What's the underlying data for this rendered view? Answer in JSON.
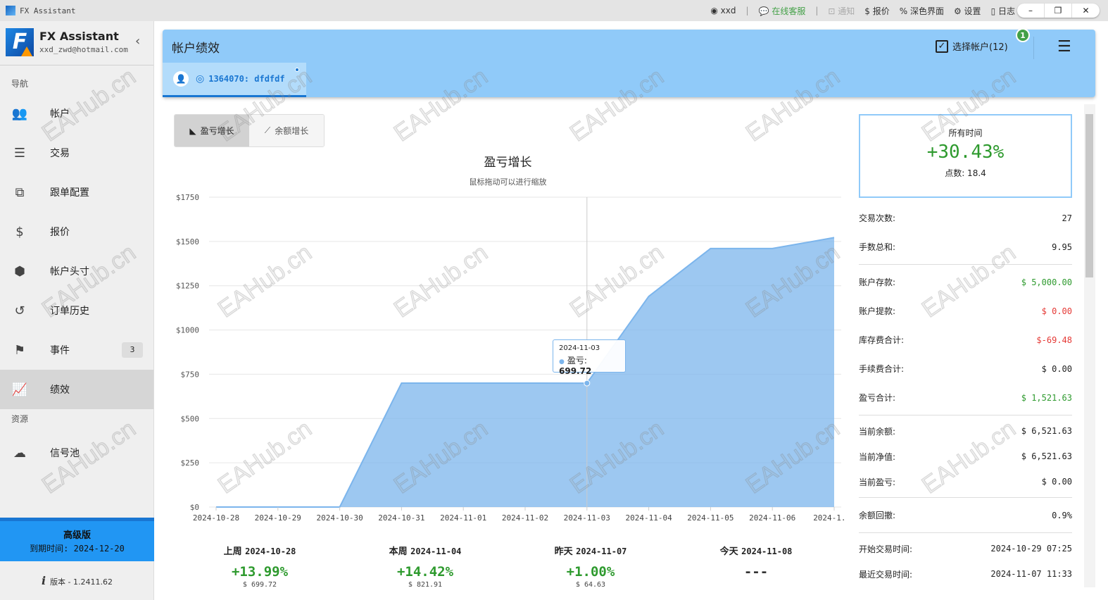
{
  "titlebar": {
    "title": "FX Assistant",
    "user": "xxd",
    "support": "在线客服",
    "notify": "通知",
    "quote": "报价",
    "dark": "深色界面",
    "settings": "设置",
    "log": "日志",
    "min": "–",
    "max": "❐",
    "close": "✕",
    "sep": "|"
  },
  "sidebar": {
    "app_name": "FX Assistant",
    "email": "xxd_zwd@hotmail.com",
    "nav_section": "导航",
    "items": [
      {
        "label": "帐户",
        "icon": "👥"
      },
      {
        "label": "交易",
        "icon": "☰"
      },
      {
        "label": "跟单配置",
        "icon": "⧉"
      },
      {
        "label": "报价",
        "icon": "$"
      },
      {
        "label": "帐户头寸",
        "icon": "⬢"
      },
      {
        "label": "订单历史",
        "icon": "↺"
      },
      {
        "label": "事件",
        "icon": "⚑",
        "badge": "3"
      },
      {
        "label": "绩效",
        "icon": "📈"
      }
    ],
    "res_section": "资源",
    "res_items": [
      {
        "label": "信号池",
        "icon": "☁"
      }
    ],
    "plan": "高级版",
    "expiry": "到期时间: 2024-12-20",
    "version": "版本 - 1.2411.62"
  },
  "header": {
    "title": "帐户绩效",
    "account": "1364070: dfdfdf",
    "select_accounts": "选择帐户(12)",
    "notif_count": "1"
  },
  "toggle": {
    "pnl": "盈亏增长",
    "balance": "余额增长"
  },
  "tooltip": {
    "date": "2024-11-03",
    "label": "盈亏:",
    "value": "699.72"
  },
  "chart_data": {
    "type": "area",
    "title": "盈亏增长",
    "subtitle": "鼠标拖动可以进行缩放",
    "x": [
      "2024-10-28",
      "2024-10-29",
      "2024-10-30",
      "2024-10-31",
      "2024-11-01",
      "2024-11-02",
      "2024-11-03",
      "2024-11-04",
      "2024-11-05",
      "2024-11-06",
      "2024-1..."
    ],
    "values": [
      0,
      0,
      0,
      700,
      700,
      700,
      699.72,
      1190,
      1460,
      1460,
      1521.63
    ],
    "yticks": [
      "$0",
      "$250",
      "$500",
      "$750",
      "$1000",
      "$1250",
      "$1500",
      "$1750"
    ],
    "ylim": [
      0,
      1750
    ],
    "color": "#7cb5ec",
    "grid": true
  },
  "periods": [
    {
      "label": "上周",
      "date": "2024-10-28",
      "pct": "+13.99%",
      "amt": "$ 699.72"
    },
    {
      "label": "本周",
      "date": "2024-11-04",
      "pct": "+14.42%",
      "amt": "$ 821.91"
    },
    {
      "label": "昨天",
      "date": "2024-11-07",
      "pct": "+1.00%",
      "amt": "$ 64.63"
    },
    {
      "label": "今天",
      "date": "2024-11-08",
      "pct": "---",
      "amt": ""
    }
  ],
  "summary": {
    "label": "所有时间",
    "pct": "+30.43%",
    "points": "点数: 18.4"
  },
  "stats": [
    {
      "k": "交易次数:",
      "v": "27"
    },
    {
      "k": "手数总和:",
      "v": "9.95"
    },
    {
      "k": "账户存款:",
      "v": "$ 5,000.00"
    },
    {
      "k": "账户提款:",
      "v": "$ 0.00"
    },
    {
      "k": "库存费合计:",
      "v": "$-69.48"
    },
    {
      "k": "手续费合计:",
      "v": "$ 0.00"
    },
    {
      "k": "盈亏合计:",
      "v": "$ 1,521.63"
    },
    {
      "k": "当前余额:",
      "v": "$ 6,521.63"
    },
    {
      "k": "当前净值:",
      "v": "$ 6,521.63"
    },
    {
      "k": "当前盈亏:",
      "v": "$ 0.00"
    },
    {
      "k": "余额回撤:",
      "v": "0.9%"
    },
    {
      "k": "开始交易时间:",
      "v": "2024-10-29 07:25"
    },
    {
      "k": "最近交易时间:",
      "v": "2024-11-07 11:33"
    }
  ],
  "watermark": "EAHub.cn"
}
